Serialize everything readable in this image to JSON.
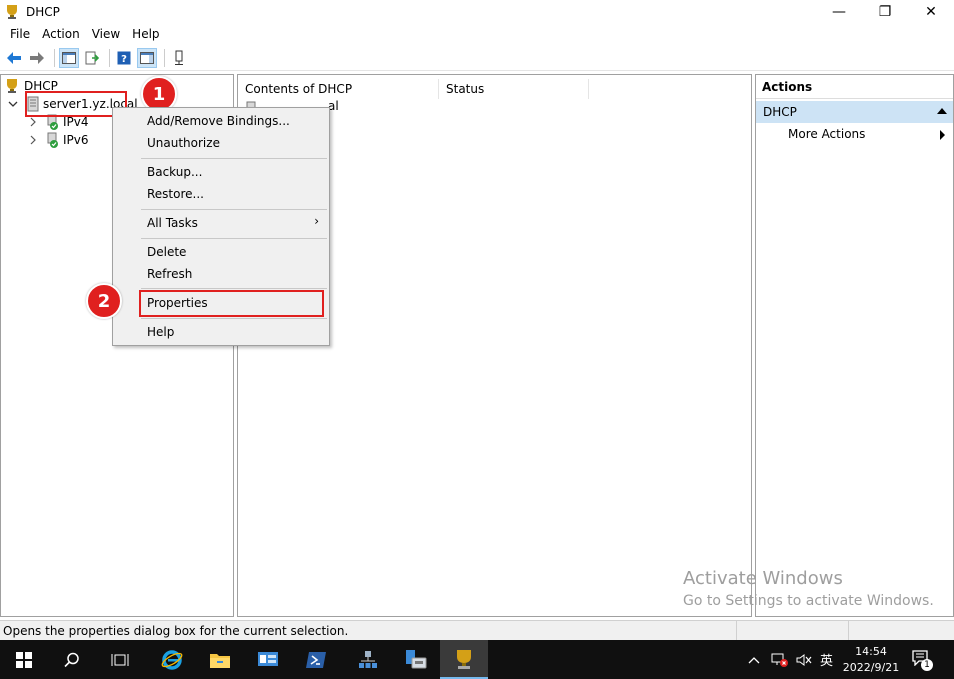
{
  "window": {
    "title": "DHCP",
    "minimize_glyph": "—",
    "maximize_glyph": "❐",
    "close_glyph": "✕"
  },
  "menu": [
    "File",
    "Action",
    "View",
    "Help"
  ],
  "toolbar_icons": [
    "back-arrow-icon",
    "forward-arrow-icon",
    "show-hide-console-tree-icon",
    "export-list-icon",
    "help-icon",
    "action-pane-icon",
    "server-status-icon"
  ],
  "tree": {
    "root": "DHCP",
    "server": "server1.yz.local",
    "children": [
      "IPv4",
      "IPv6"
    ]
  },
  "content": {
    "columns": [
      "Contents of DHCP",
      "Status"
    ],
    "row_partial": "al"
  },
  "actions": {
    "title": "Actions",
    "section": "DHCP",
    "more": "More Actions"
  },
  "context_menu": {
    "add_remove": "Add/Remove Bindings...",
    "unauthorize": "Unauthorize",
    "backup": "Backup...",
    "restore": "Restore...",
    "all_tasks": "All Tasks",
    "all_tasks_arrow": "›",
    "delete": "Delete",
    "refresh": "Refresh",
    "properties": "Properties",
    "help": "Help"
  },
  "annotations": {
    "step1": "1",
    "step2": "2"
  },
  "watermark": {
    "line1": "Activate Windows",
    "line2": "Go to Settings to activate Windows."
  },
  "status_text": "Opens the properties dialog box for the current selection.",
  "taskbar": {
    "time": "14:54",
    "date": "2022/9/21",
    "ime": "英",
    "notification_count": "1"
  },
  "colors": {
    "highlight_red": "#e0201f",
    "selection_blue": "#cde3f5",
    "taskbar": "#101010"
  }
}
